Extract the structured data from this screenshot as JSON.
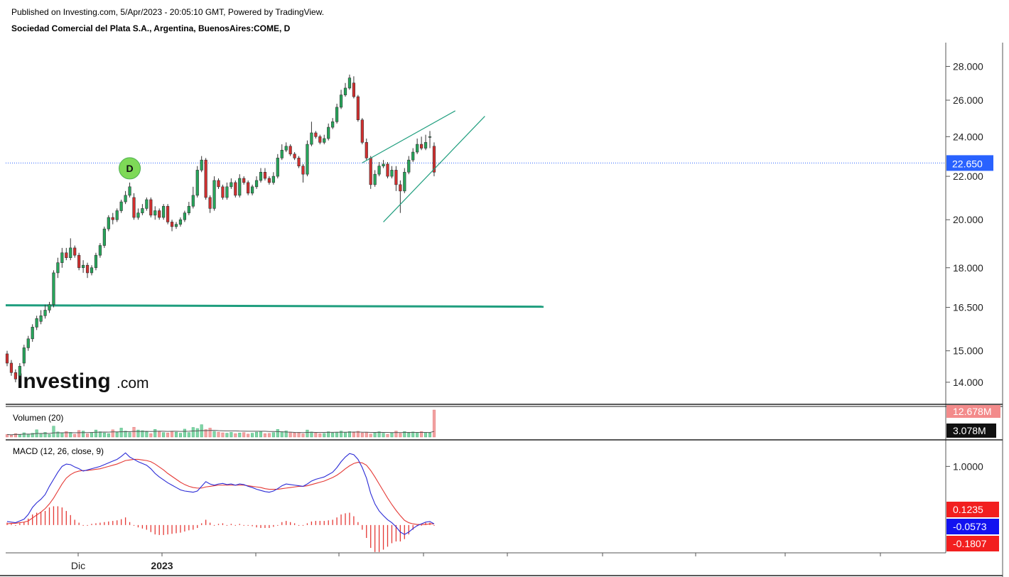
{
  "header": {
    "published": "Published on Investing.com, 5/Apr/2023 - 20:05:10 GMT, Powered by TradingView.",
    "instrument": "Sociedad Comercial del Plata S.A., Argentina, BuenosAires:COME, D"
  },
  "logo": {
    "brand": "Investing",
    "suffix": ".com"
  },
  "colors": {
    "up": "#26a65b",
    "down": "#d32f2f",
    "support_line": "#1f9e7e",
    "channel_line": "#1f9e7e",
    "macd_line": "#2b2bd6",
    "signal_line": "#e53935",
    "histogram": "#e53935",
    "last_price": "#2962ff",
    "dividend_marker": "#7ed957"
  },
  "chart_data": [
    {
      "type": "candlestick",
      "title": "Sociedad Comercial del Plata S.A., Argentina, BuenosAires:COME, D",
      "y_scale": "log",
      "y_ticks": [
        14.0,
        15.0,
        16.5,
        18.0,
        20.0,
        22.0,
        24.0,
        26.0,
        28.0
      ],
      "y_tick_labels": [
        "14.000",
        "15.000",
        "16.500",
        "18.000",
        "20.000",
        "22.000",
        "24.000",
        "26.000",
        "28.000"
      ],
      "ylim": [
        13.4,
        29.5
      ],
      "x_tick_labels": [
        "Dic",
        "2023"
      ],
      "last_price": 22.65,
      "last_price_label": "22.650",
      "dividend_marker": {
        "label": "D",
        "bar": 29
      },
      "support_line": {
        "value": 16.55
      },
      "channel": {
        "upper": {
          "from": [
            84,
            22.66
          ],
          "to [ignore]": null
        },
        "upper_line": [
          [
            84,
            22.66
          ],
          [
            106,
            25.4
          ]
        ],
        "lower_line": [
          [
            89,
            19.9
          ],
          [
            113,
            25.1
          ]
        ]
      },
      "close": [
        14.6,
        14.3,
        14.1,
        14.5,
        15.1,
        15.4,
        15.8,
        16.1,
        16.2,
        16.4,
        16.6,
        17.8,
        18.2,
        18.6,
        18.4,
        18.8,
        18.5,
        18.0,
        18.1,
        17.8,
        18.0,
        18.5,
        18.9,
        19.6,
        20.1,
        20.0,
        20.4,
        20.8,
        21.1,
        21.5,
        20.1,
        20.3,
        20.5,
        20.9,
        20.2,
        20.4,
        20.1,
        20.6,
        19.9,
        19.7,
        19.8,
        20.0,
        20.3,
        20.6,
        21.1,
        22.3,
        22.8,
        21.0,
        20.5,
        21.8,
        21.5,
        21.0,
        21.5,
        21.7,
        21.1,
        21.9,
        21.7,
        21.2,
        21.5,
        21.8,
        22.2,
        21.9,
        21.7,
        22.0,
        22.9,
        23.3,
        23.5,
        23.1,
        22.9,
        22.5,
        22.1,
        23.6,
        24.2,
        24.0,
        23.7,
        23.9,
        24.5,
        24.8,
        25.6,
        26.3,
        26.7,
        27.3,
        26.2,
        24.9,
        23.7,
        22.9,
        21.6,
        22.1,
        22.5,
        22.6,
        22.0,
        22.3,
        21.6,
        21.3,
        22.2,
        22.8,
        23.2,
        23.6,
        23.4,
        23.7,
        24.0,
        22.2
      ],
      "open": [
        14.9,
        14.6,
        14.3,
        14.2,
        14.6,
        15.1,
        15.4,
        15.8,
        16.0,
        16.2,
        16.4,
        16.6,
        17.8,
        18.2,
        18.6,
        18.4,
        18.8,
        18.5,
        18.0,
        18.1,
        17.8,
        18.0,
        18.5,
        18.9,
        19.6,
        20.1,
        20.0,
        20.4,
        20.8,
        21.1,
        21.0,
        20.1,
        20.3,
        20.5,
        20.9,
        20.2,
        20.4,
        20.1,
        20.6,
        19.9,
        19.7,
        19.8,
        20.0,
        20.3,
        20.6,
        21.1,
        22.3,
        22.8,
        21.0,
        20.5,
        21.8,
        21.5,
        21.0,
        21.5,
        21.7,
        21.1,
        21.9,
        21.7,
        21.2,
        21.5,
        21.8,
        22.2,
        21.9,
        21.7,
        22.0,
        22.9,
        23.3,
        23.5,
        23.1,
        22.9,
        22.5,
        22.1,
        23.6,
        24.2,
        24.0,
        23.7,
        23.9,
        24.5,
        24.8,
        25.6,
        26.3,
        26.7,
        27.0,
        26.2,
        24.9,
        23.7,
        22.9,
        21.6,
        22.1,
        22.5,
        22.6,
        22.0,
        22.3,
        21.6,
        21.3,
        22.2,
        22.8,
        23.2,
        23.6,
        23.4,
        24.0,
        23.5
      ],
      "high": [
        15.0,
        14.7,
        14.4,
        14.6,
        15.2,
        15.5,
        15.9,
        16.2,
        16.4,
        16.6,
        16.7,
        17.9,
        18.4,
        18.8,
        18.8,
        19.2,
        18.9,
        18.6,
        18.3,
        18.2,
        18.1,
        18.6,
        19.0,
        19.7,
        20.2,
        20.3,
        20.5,
        20.9,
        21.3,
        21.7,
        21.2,
        20.5,
        20.7,
        21.0,
        21.0,
        20.6,
        20.5,
        20.7,
        20.7,
        20.0,
        19.9,
        20.1,
        20.4,
        20.8,
        21.5,
        22.5,
        23.0,
        22.9,
        21.1,
        22.0,
        21.9,
        21.6,
        21.7,
        21.9,
        21.8,
        22.1,
        22.0,
        21.8,
        21.6,
        22.0,
        22.4,
        22.4,
        22.0,
        22.2,
        23.1,
        23.6,
        23.7,
        23.6,
        23.2,
        23.0,
        22.6,
        23.8,
        24.8,
        24.3,
        24.1,
        24.1,
        24.7,
        25.0,
        25.8,
        26.6,
        27.0,
        27.5,
        27.4,
        26.3,
        25.0,
        23.9,
        23.0,
        22.3,
        22.7,
        22.8,
        22.7,
        22.5,
        22.5,
        21.8,
        22.4,
        23.0,
        23.4,
        23.9,
        24.0,
        24.1,
        24.3,
        23.7
      ],
      "low": [
        14.5,
        14.2,
        14.0,
        14.1,
        14.5,
        15.0,
        15.3,
        15.7,
        15.9,
        16.1,
        16.3,
        16.5,
        17.6,
        18.0,
        18.3,
        18.3,
        18.4,
        17.9,
        17.8,
        17.6,
        17.7,
        17.9,
        18.4,
        18.8,
        19.5,
        19.8,
        19.9,
        20.3,
        20.7,
        21.0,
        20.0,
        20.0,
        20.2,
        20.4,
        20.1,
        20.0,
        20.0,
        20.0,
        19.8,
        19.5,
        19.6,
        19.7,
        19.9,
        20.2,
        20.5,
        21.0,
        22.2,
        20.9,
        20.3,
        20.4,
        21.4,
        20.9,
        20.9,
        21.4,
        21.0,
        21.0,
        21.6,
        21.1,
        21.1,
        21.4,
        21.7,
        21.8,
        21.6,
        21.6,
        21.9,
        22.8,
        23.2,
        23.0,
        22.8,
        22.4,
        21.7,
        22.0,
        23.5,
        23.9,
        23.6,
        23.6,
        23.8,
        24.4,
        24.7,
        25.5,
        26.2,
        26.6,
        26.1,
        24.8,
        23.6,
        22.8,
        21.4,
        21.5,
        22.0,
        22.4,
        21.9,
        21.9,
        21.3,
        20.3,
        21.2,
        22.1,
        22.7,
        23.1,
        23.3,
        23.3,
        23.4,
        22.0
      ]
    },
    {
      "type": "bar",
      "title": "Volumen (20)",
      "value_labels": [
        "12.678M",
        "3.078M"
      ],
      "volume_m": [
        1.2,
        0.9,
        1.6,
        1.1,
        2.0,
        1.4,
        1.8,
        3.4,
        1.6,
        2.2,
        1.2,
        5.1,
        2.4,
        1.9,
        2.6,
        2.2,
        1.3,
        3.1,
        2.8,
        1.5,
        2.2,
        3.3,
        2.5,
        1.9,
        1.6,
        3.4,
        2.2,
        4.2,
        2.8,
        2.1,
        4.6,
        3.3,
        3.0,
        2.4,
        1.6,
        3.6,
        2.7,
        2.1,
        1.9,
        2.5,
        2.3,
        1.8,
        3.7,
        2.1,
        4.5,
        4.0,
        5.8,
        3.5,
        4.2,
        2.6,
        2.3,
        2.0,
        1.8,
        2.2,
        1.6,
        1.9,
        2.1,
        1.4,
        1.8,
        2.3,
        2.6,
        1.6,
        1.7,
        2.1,
        3.6,
        2.5,
        2.9,
        2.3,
        1.9,
        2.2,
        1.5,
        3.3,
        2.4,
        2.0,
        1.6,
        1.7,
        2.5,
        1.9,
        2.3,
        2.8,
        2.2,
        2.6,
        2.1,
        2.7,
        1.9,
        2.3,
        1.4,
        2.0,
        2.5,
        1.8,
        1.3,
        2.0,
        2.8,
        1.7,
        2.6,
        1.9,
        2.4,
        2.1,
        2.6,
        2.2,
        1.9,
        12.678
      ],
      "average_m": 3.078,
      "ylim": [
        0,
        12.678
      ]
    },
    {
      "type": "line",
      "title": "MACD (12, 26, close, 9)",
      "y_ticks": [
        1.0
      ],
      "y_tick_labels": [
        "1.0000"
      ],
      "value_labels": [
        "0.1235",
        "-0.0573",
        "-0.1807"
      ],
      "ylim": [
        -0.45,
        1.38
      ],
      "macd": [
        0.06,
        0.05,
        0.04,
        0.07,
        0.1,
        0.18,
        0.3,
        0.38,
        0.44,
        0.52,
        0.66,
        0.78,
        0.9,
        1.0,
        1.04,
        1.03,
        0.99,
        0.96,
        0.92,
        0.94,
        0.96,
        0.98,
        1.0,
        1.03,
        1.06,
        1.09,
        1.12,
        1.17,
        1.23,
        1.16,
        1.12,
        1.08,
        1.05,
        1.02,
        0.96,
        0.88,
        0.82,
        0.77,
        0.72,
        0.68,
        0.64,
        0.6,
        0.58,
        0.57,
        0.56,
        0.58,
        0.66,
        0.74,
        0.7,
        0.68,
        0.7,
        0.71,
        0.69,
        0.7,
        0.68,
        0.7,
        0.69,
        0.66,
        0.64,
        0.61,
        0.59,
        0.57,
        0.56,
        0.58,
        0.62,
        0.67,
        0.7,
        0.69,
        0.68,
        0.67,
        0.66,
        0.7,
        0.75,
        0.78,
        0.8,
        0.82,
        0.86,
        0.9,
        0.98,
        1.08,
        1.16,
        1.22,
        1.2,
        1.12,
        0.98,
        0.8,
        0.54,
        0.36,
        0.24,
        0.16,
        0.09,
        0.04,
        -0.03,
        -0.12,
        -0.16,
        -0.12,
        -0.06,
        -0.01,
        0.02,
        0.05,
        0.06,
        0.02
      ],
      "signal": [
        0.02,
        0.03,
        0.03,
        0.04,
        0.05,
        0.07,
        0.12,
        0.17,
        0.22,
        0.28,
        0.36,
        0.46,
        0.58,
        0.7,
        0.8,
        0.86,
        0.9,
        0.92,
        0.93,
        0.93,
        0.94,
        0.95,
        0.96,
        0.98,
        1.0,
        1.02,
        1.04,
        1.07,
        1.1,
        1.11,
        1.12,
        1.12,
        1.11,
        1.1,
        1.08,
        1.04,
        0.99,
        0.94,
        0.88,
        0.83,
        0.78,
        0.73,
        0.69,
        0.66,
        0.64,
        0.63,
        0.63,
        0.65,
        0.66,
        0.67,
        0.68,
        0.68,
        0.68,
        0.68,
        0.68,
        0.68,
        0.68,
        0.67,
        0.66,
        0.65,
        0.64,
        0.62,
        0.61,
        0.61,
        0.61,
        0.62,
        0.63,
        0.64,
        0.65,
        0.66,
        0.66,
        0.67,
        0.69,
        0.71,
        0.73,
        0.75,
        0.78,
        0.81,
        0.85,
        0.9,
        0.96,
        1.01,
        1.05,
        1.07,
        1.06,
        1.02,
        0.93,
        0.82,
        0.7,
        0.58,
        0.46,
        0.35,
        0.25,
        0.16,
        0.08,
        0.04,
        0.02,
        0.01,
        0.01,
        0.01,
        0.02,
        0.02
      ]
    }
  ]
}
